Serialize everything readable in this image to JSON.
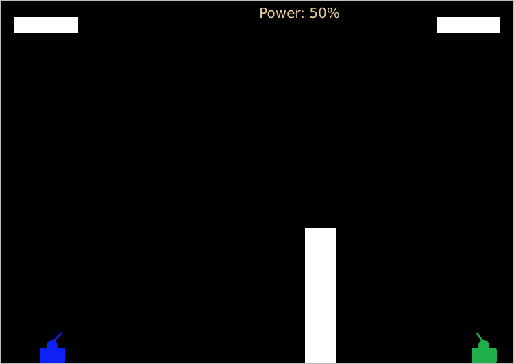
{
  "hud": {
    "power_label": "Power: 50%",
    "power_percent": 50
  },
  "players": [
    {
      "name": "left-tank",
      "color": "#0b21f5",
      "health_fraction": 1.0
    },
    {
      "name": "right-tank",
      "color": "#20b04b",
      "health_fraction": 1.0
    }
  ],
  "colors": {
    "background": "#000000",
    "hud_text": "#e8c99b",
    "wall": "#ffffff",
    "health_bar": "#ffffff"
  }
}
